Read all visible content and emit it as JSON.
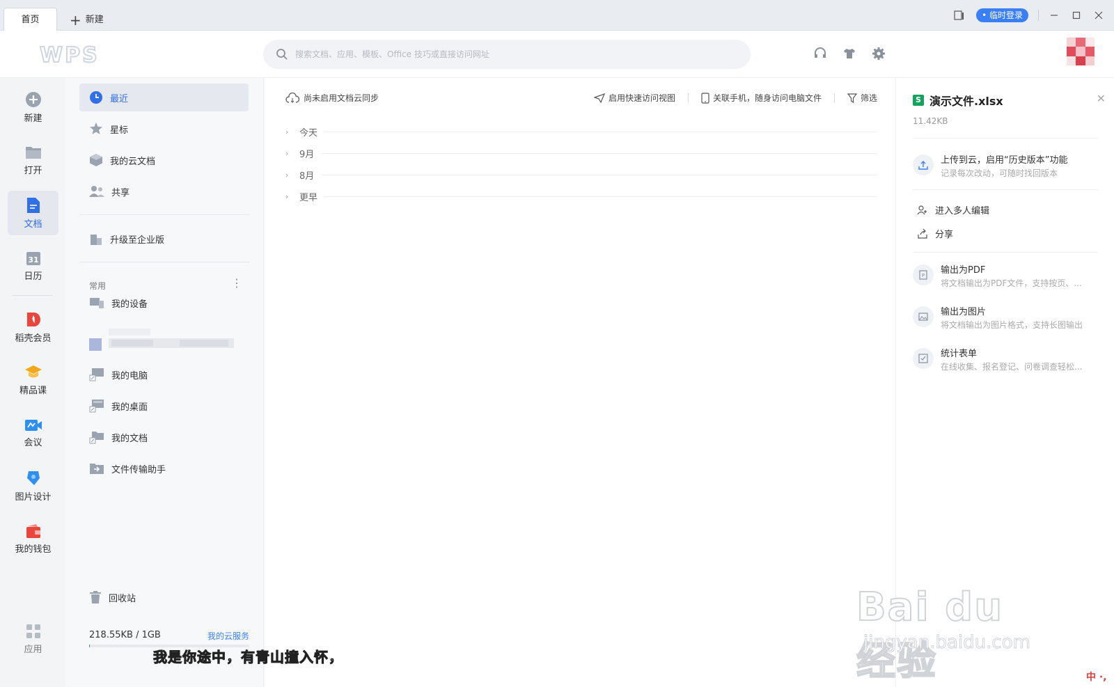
{
  "titlebar": {
    "tab_home": "首页",
    "tab_new": "新建",
    "login": "• 临时登录"
  },
  "header": {
    "logo": "WPS",
    "search_placeholder": "搜索文档、应用、模板、Office 技巧或直接访问网址"
  },
  "rail": {
    "items": [
      {
        "label": "新建"
      },
      {
        "label": "打开"
      },
      {
        "label": "文档"
      },
      {
        "label": "日历"
      },
      {
        "label": "稻壳会员"
      },
      {
        "label": "精品课"
      },
      {
        "label": "会议"
      },
      {
        "label": "图片设计"
      },
      {
        "label": "我的钱包"
      },
      {
        "label": "应用"
      }
    ],
    "calendar_day": "31"
  },
  "sidenav": {
    "items": [
      {
        "label": "最近"
      },
      {
        "label": "星标"
      },
      {
        "label": "我的云文档"
      },
      {
        "label": "共享"
      },
      {
        "label": "升级至企业版"
      }
    ],
    "group_label": "常用",
    "group_more": "⋮",
    "common": [
      {
        "label": "我的设备"
      },
      {
        "label": "我的电脑"
      },
      {
        "label": "我的桌面"
      },
      {
        "label": "我的文档"
      },
      {
        "label": "文件传输助手"
      }
    ],
    "recycle": "回收站",
    "storage_text": "218.55KB / 1GB",
    "storage_link": "我的云服务",
    "storage_fraction": 0.0002
  },
  "main": {
    "sync_text": "尚未启用文档云同步",
    "quick_view": "启用快速访问视图",
    "phone_link": "关联手机，随身访问电脑文件",
    "filter": "筛选",
    "groups": [
      {
        "label": "今天"
      },
      {
        "label": "9月"
      },
      {
        "label": "8月"
      },
      {
        "label": "更早"
      }
    ],
    "caption": "我是你途中，有青山撞入怀，"
  },
  "panel": {
    "file_name": "演示文件.xlsx",
    "file_icon_letter": "S",
    "file_size": "11.42KB",
    "upload_title": "上传到云，启用“历史版本”功能",
    "upload_desc": "记录每次改动，可随时找回版本",
    "multi_edit": "进入多人编辑",
    "share": "分享",
    "pdf_title": "输出为PDF",
    "pdf_desc": "将文档输出为PDF文件，支持按页、...",
    "img_title": "输出为图片",
    "img_desc": "将文档输出为图片格式，支持长图输出",
    "form_title": "统计表单",
    "form_desc": "在线收集、报名登记、问卷调查轻松..."
  },
  "watermark": {
    "main": "Bai du 经验",
    "sub": "jingyan.baidu.com"
  },
  "ime": "中 ·,",
  "colors": {
    "accent": "#3a7ff5",
    "active_text": "#2f6fe8",
    "excel_green": "#14a35e"
  }
}
